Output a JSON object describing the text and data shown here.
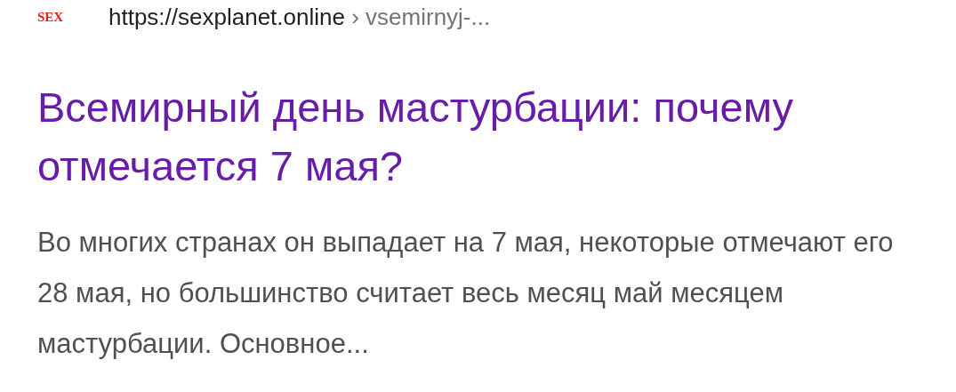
{
  "result": {
    "favicon": "SEX",
    "url": "https://sexplanet.online",
    "breadcrumb": "› vsemirnyj-...",
    "title": "Всемирный день мастурбации: почему отмечается 7 мая?",
    "visited": true,
    "snippet": "Во многих странах он выпадает на 7 мая, некоторые отмечают его 28 мая, но большинство считает весь месяц май месяцем мастурбации. Основное..."
  }
}
